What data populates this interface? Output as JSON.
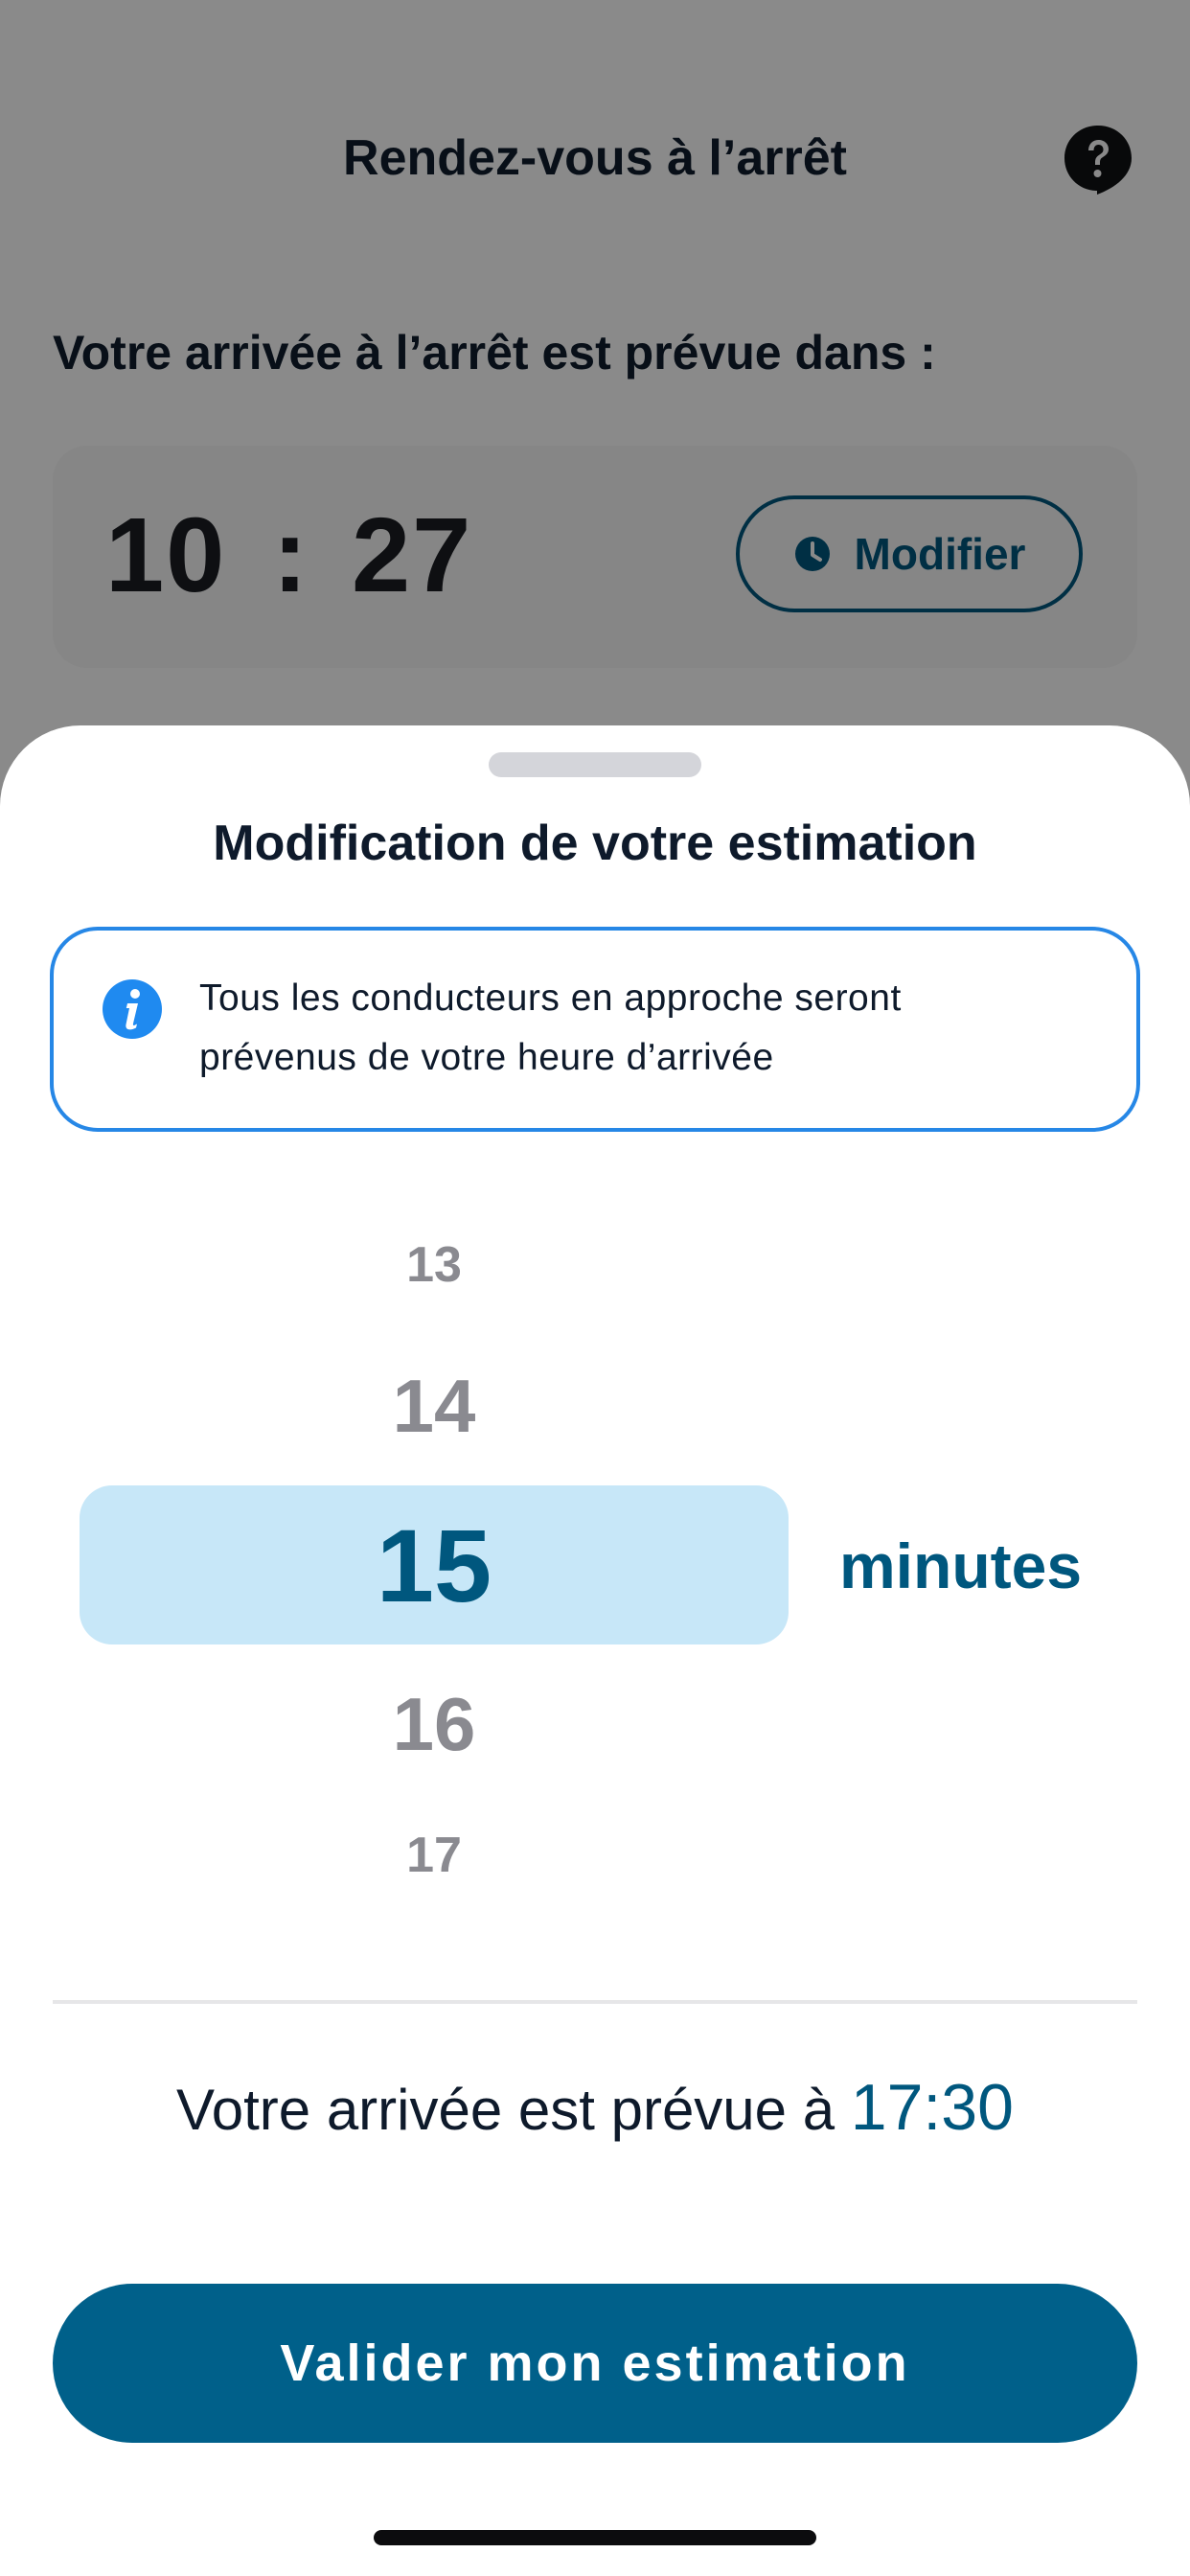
{
  "background": {
    "header_title": "Rendez-vous à l’arrêt",
    "help_icon": "help-question-bubble-icon",
    "subtitle": "Votre arrivée à l’arrêt est prévue dans :",
    "time": {
      "hours": "10",
      "separator": ":",
      "minutes": "27"
    },
    "modify_button": {
      "icon": "clock-icon",
      "label": "Modifier"
    }
  },
  "sheet": {
    "title": "Modification de votre estimation",
    "info": {
      "icon": "info-icon",
      "line1": "Tous les conducteurs en approche seront",
      "line2": "prévenus de votre heure d’arrivée"
    },
    "picker": {
      "values_above": [
        "13",
        "14"
      ],
      "selected": "15",
      "values_below": [
        "16",
        "17"
      ],
      "unit": "minutes"
    },
    "arrival": {
      "prefix": "Votre arrivée est prévue à",
      "time": "17:30"
    },
    "submit_label": "Valider mon estimation"
  },
  "colors": {
    "primary": "#00577e",
    "button_bg": "#00608a",
    "selected_bg": "#c7e7f8",
    "info_border": "#2687e6",
    "info_icon": "#1f8af0"
  }
}
